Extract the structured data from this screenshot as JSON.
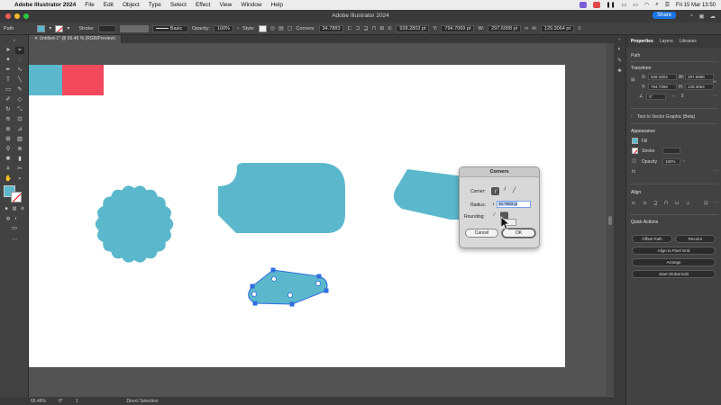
{
  "menubar": {
    "app_name": "Adobe Illustrator 2024",
    "items": [
      "File",
      "Edit",
      "Object",
      "Type",
      "Select",
      "Effect",
      "View",
      "Window",
      "Help"
    ],
    "clock": "Fri 15 Mar  13:50"
  },
  "titlebar": {
    "title": "Adobe Illustrator 2024",
    "share_label": "Share"
  },
  "controlbar": {
    "selection_type": "Path",
    "stroke_label": "Stroke:",
    "brush_label": "Basic",
    "opacity_label": "Opacity:",
    "opacity_value": "100%",
    "style_label": "Style:",
    "corners_label": "Corners:",
    "corners_value": "34.7883",
    "x_label": "X:",
    "x_value": "928.2803 pt",
    "y_label": "Y:",
    "y_value": "794.7069 pt",
    "w_label": "W:",
    "w_value": "297.6998 pt",
    "h_label": "H:",
    "h_value": "129.3064 pt"
  },
  "document": {
    "tab_label": "Untitled-1* @ 66.46 % (RGB/Preview)"
  },
  "statusbar": {
    "zoom": "66.46%",
    "rotation": "0°",
    "artboard": "1",
    "tool": "Direct Selection"
  },
  "properties": {
    "tabs": [
      "Properties",
      "Layers",
      "Libraries"
    ],
    "selection": "Path",
    "transform_title": "Transform",
    "x_label": "X:",
    "x_value": "928.2803",
    "y_label": "Y:",
    "y_value": "794.7069",
    "w_label": "W:",
    "w_value": "297.6998",
    "h_label": "H:",
    "h_value": "129.3064",
    "angle_value": "0°",
    "text_to_vector": "Text to Vector Graphic (Beta)",
    "appearance_title": "Appearance",
    "fill_label": "Fill",
    "stroke_label": "Stroke",
    "opacity_label": "Opacity",
    "opacity_value": "100%",
    "fx_label": "fx",
    "align_title": "Align",
    "quick_actions_title": "Quick Actions",
    "offset_path": "Offset Path",
    "recolor": "Recolor",
    "align_pixel_grid": "Align to Pixel Grid",
    "arrange": "Arrange",
    "start_global_edit": "Start Global Edit"
  },
  "dialog": {
    "title": "Corners",
    "corner_label": "Corner:",
    "radius_label": "Radius:",
    "radius_value": "34.7883 pt",
    "rounding_label": "Rounding:",
    "cancel_label": "Cancel",
    "ok_label": "OK"
  },
  "colors": {
    "fill_teal": "#5bb8cc",
    "red": "#f2495c",
    "accent_blue": "#1a73e8"
  }
}
